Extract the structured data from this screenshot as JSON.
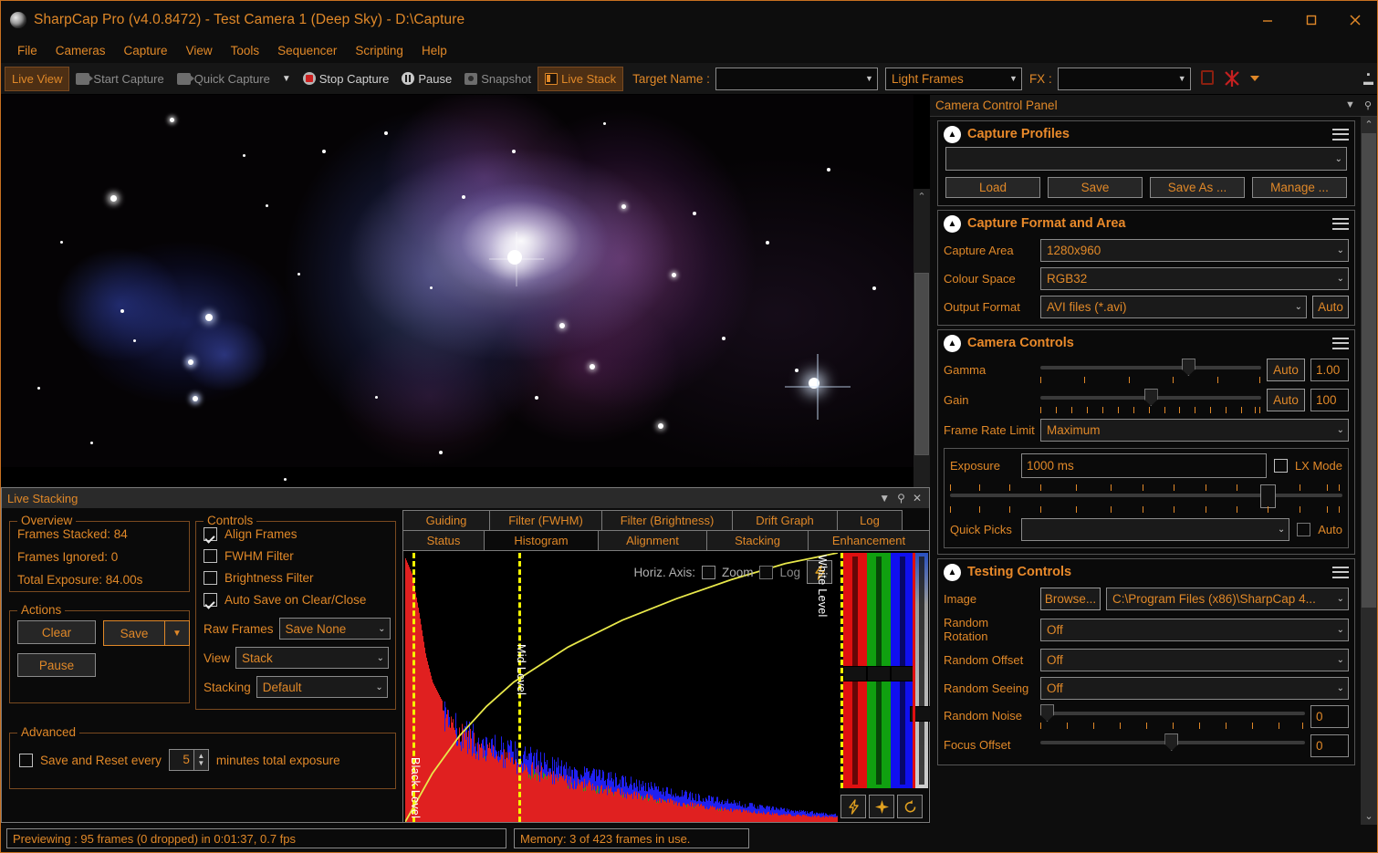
{
  "window": {
    "title": "SharpCap Pro (v4.0.8472) - Test Camera 1 (Deep Sky) - D:\\Capture",
    "app_icon": "app-logo-icon",
    "minimize": "minimize-icon",
    "maximize": "maximize-icon",
    "close": "close-icon"
  },
  "menubar": {
    "items": [
      {
        "label": "File"
      },
      {
        "label": "Cameras"
      },
      {
        "label": "Capture"
      },
      {
        "label": "View"
      },
      {
        "label": "Tools"
      },
      {
        "label": "Sequencer"
      },
      {
        "label": "Scripting"
      },
      {
        "label": "Help"
      }
    ]
  },
  "toolbar": {
    "live_view": "Live View",
    "start_capture": "Start Capture",
    "quick_capture": "Quick Capture",
    "dropdown_caret": "▼",
    "stop_capture": "Stop Capture",
    "pause": "Pause",
    "snapshot": "Snapshot",
    "live_stack": "Live Stack",
    "target_name_label": "Target Name :",
    "target_name_value": "",
    "frame_type_value": "Light Frames",
    "fx_label": "FX :",
    "fx_value": "",
    "icons": [
      "square-outline-icon",
      "no-fx-icon",
      "chevron-down-icon",
      "overflow-icon"
    ]
  },
  "image_view": {
    "object": "Orion Nebula preview",
    "scroll_left": "‹",
    "scroll_right": "›",
    "scroll_up": "⌃",
    "scroll_down": "⌄"
  },
  "live_stacking": {
    "title": "Live Stacking",
    "title_buttons": [
      "▼",
      "⚲",
      "✕"
    ],
    "overview": {
      "legend": "Overview",
      "rows": [
        "Frames Stacked: 84",
        "Frames Ignored: 0",
        "Total Exposure:  84.00s"
      ]
    },
    "actions": {
      "legend": "Actions",
      "clear": "Clear",
      "save": "Save",
      "save_caret": "▼",
      "pause": "Pause"
    },
    "controls": {
      "legend": "Controls",
      "checkboxes": [
        {
          "label": "Align Frames",
          "checked": true
        },
        {
          "label": "FWHM Filter",
          "checked": false
        },
        {
          "label": "Brightness Filter",
          "checked": false
        },
        {
          "label": "Auto Save on Clear/Close",
          "checked": true
        }
      ],
      "raw_frames_label": "Raw Frames",
      "raw_frames_value": "Save None",
      "view_label": "View",
      "view_value": "Stack",
      "stacking_label": "Stacking",
      "stacking_value": "Default"
    },
    "advanced": {
      "legend": "Advanced",
      "save_reset_checked": false,
      "save_reset_prefix": "Save and Reset every",
      "minutes_value": "5",
      "save_reset_suffix": "minutes total exposure"
    }
  },
  "hist_panel": {
    "tabs_top": [
      "Guiding",
      "Filter (FWHM)",
      "Filter (Brightness)",
      "Drift Graph",
      "Log"
    ],
    "tabs_bottom": [
      "Status",
      "Histogram",
      "Alignment",
      "Stacking",
      "Enhancement"
    ],
    "selected_tab": "Histogram",
    "horiz_axis_label": "Horiz. Axis:",
    "zoom_label": "Zoom",
    "zoom_checked": false,
    "log_label": "Log",
    "log_checked": false,
    "black_level_label": "Black Level",
    "mid_level_label": "Mid Level",
    "white_level_label": "White Level",
    "buttons": [
      "auto-stretch-icon",
      "star-stretch-icon",
      "reset-icon"
    ],
    "auto_icon": "lightning-icon"
  },
  "chart_data": {
    "type": "area",
    "title": "Histogram",
    "xlabel": "",
    "ylabel": "",
    "xlim": [
      0,
      255
    ],
    "ylim": [
      0,
      100
    ],
    "grid": false,
    "legend": "none",
    "markers": {
      "black_level": 2,
      "mid_level": 64,
      "white_level": 253
    },
    "stretch_curve": {
      "name": "Stretch curve",
      "color": "#e8e84a",
      "x": [
        0,
        16,
        32,
        48,
        64,
        96,
        128,
        160,
        192,
        224,
        255
      ],
      "y": [
        0,
        18,
        32,
        43,
        52,
        65,
        75,
        83,
        90,
        96,
        100
      ]
    },
    "series": [
      {
        "name": "Red",
        "color": "#e02020",
        "x": [
          0,
          4,
          8,
          12,
          16,
          24,
          32,
          48,
          64,
          96,
          128,
          160,
          192,
          224,
          255
        ],
        "y": [
          98,
          92,
          78,
          62,
          52,
          42,
          36,
          30,
          24,
          17,
          12,
          8,
          5,
          3,
          2
        ]
      },
      {
        "name": "Green",
        "color": "#20a020",
        "x": [
          0,
          4,
          8,
          12,
          16,
          24,
          32,
          48,
          64,
          96,
          128,
          160,
          192,
          224,
          255
        ],
        "y": [
          96,
          70,
          50,
          40,
          34,
          30,
          27,
          24,
          21,
          15,
          11,
          7,
          4,
          2,
          1
        ]
      },
      {
        "name": "Blue",
        "color": "#2020f0",
        "x": [
          0,
          4,
          8,
          12,
          16,
          24,
          32,
          48,
          64,
          96,
          128,
          160,
          192,
          224,
          255
        ],
        "y": [
          95,
          88,
          72,
          58,
          50,
          43,
          38,
          33,
          29,
          22,
          17,
          12,
          8,
          5,
          3
        ]
      }
    ]
  },
  "camera_panel": {
    "title": "Camera Control Panel",
    "title_buttons": [
      "▼",
      "⚲"
    ],
    "sections": {
      "capture_profiles": {
        "title": "Capture Profiles",
        "profile_value": "",
        "load": "Load",
        "save": "Save",
        "save_as": "Save As ...",
        "manage": "Manage ..."
      },
      "capture_format": {
        "title": "Capture Format and Area",
        "capture_area_label": "Capture Area",
        "capture_area_value": "1280x960",
        "colour_space_label": "Colour Space",
        "colour_space_value": "RGB32",
        "output_format_label": "Output Format",
        "output_format_value": "AVI files (*.avi)",
        "output_auto": "Auto"
      },
      "camera_controls": {
        "title": "Camera Controls",
        "gamma_label": "Gamma",
        "gamma_auto": "Auto",
        "gamma_value": "1.00",
        "gamma_pct": 74,
        "gain_label": "Gain",
        "gain_auto": "Auto",
        "gain_value": "100",
        "gain_pct": 48,
        "frame_rate_label": "Frame Rate Limit",
        "frame_rate_value": "Maximum",
        "exposure_label": "Exposure",
        "exposure_value": "1000 ms",
        "exposure_pct": 79,
        "lx_mode_label": "LX Mode",
        "lx_mode_checked": false,
        "quick_picks_label": "Quick Picks",
        "quick_picks_value": "",
        "quick_picks_auto": "Auto",
        "quick_picks_auto_checked": false
      },
      "testing_controls": {
        "title": "Testing Controls",
        "image_label": "Image",
        "browse": "Browse...",
        "image_value": "C:\\Program Files (x86)\\SharpCap 4...",
        "random_rotation_label": "Random Rotation",
        "random_rotation_value": "Off",
        "random_offset_label": "Random Offset",
        "random_offset_value": "Off",
        "random_seeing_label": "Random Seeing",
        "random_seeing_value": "Off",
        "random_noise_label": "Random Noise",
        "random_noise_value": "0",
        "random_noise_pct": 0,
        "focus_offset_label": "Focus Offset",
        "focus_offset_value": "0",
        "focus_offset_pct": 48
      }
    }
  },
  "statusbar": {
    "preview": "Previewing : 95 frames (0 dropped) in 0:01:37, 0.7 fps",
    "memory": "Memory: 3 of 423 frames in use."
  },
  "colors": {
    "accent": "#e08828",
    "accent_bright": "#e8892a",
    "panel_bg": "#0a0a0a",
    "border": "#7a7a7a",
    "marker_yellow": "#f5f500",
    "red": "#e02020",
    "green": "#20a020",
    "blue": "#2020f0"
  }
}
